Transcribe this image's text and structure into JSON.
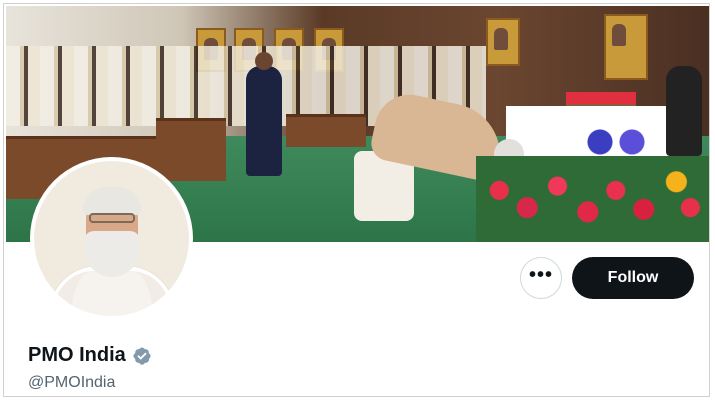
{
  "profile": {
    "display_name": "PMO India",
    "handle": "@PMOIndia",
    "verified_icon": "verified-badge-icon",
    "verified_color": "#829aab"
  },
  "actions": {
    "more_icon": "more-options-icon",
    "more_label": "•••",
    "follow_label": "Follow",
    "follow_bg": "#0f1419",
    "follow_text_color": "#ffffff"
  },
  "colors": {
    "name_text": "#0f1419",
    "handle_text": "#536471",
    "border": "#cfd9de"
  }
}
